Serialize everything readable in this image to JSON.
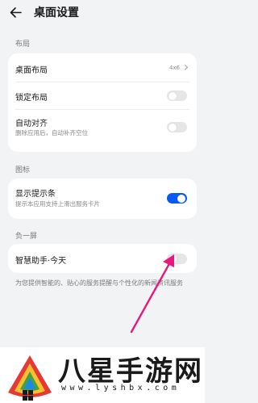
{
  "header": {
    "title": "桌面设置"
  },
  "sections": {
    "layout": {
      "label": "布局",
      "desktop_layout": {
        "title": "桌面布局",
        "value": "4x6"
      },
      "lock_layout": {
        "title": "锁定布局",
        "enabled": false
      },
      "auto_align": {
        "title": "自动对齐",
        "subtitle": "删除应用后，自动补齐空位",
        "enabled": false
      }
    },
    "icons": {
      "label": "图标",
      "show_hint_bar": {
        "title": "显示提示条",
        "subtitle": "提示本应用支持上滑出服务卡片",
        "enabled": true
      }
    },
    "minus_one_screen": {
      "label": "负一屏",
      "smart_assistant": {
        "title": "智慧助手·今天",
        "enabled": false
      },
      "footnote": "为您提供智能的、贴心的服务提醒与个性化的新闻资讯服务"
    }
  },
  "colors": {
    "accent": "#0a59f7",
    "annotation_arrow": "#e8197c",
    "background": "#f1f3f5"
  },
  "watermark": {
    "name": "八星手游网",
    "url": "www.lyshbx.com"
  }
}
